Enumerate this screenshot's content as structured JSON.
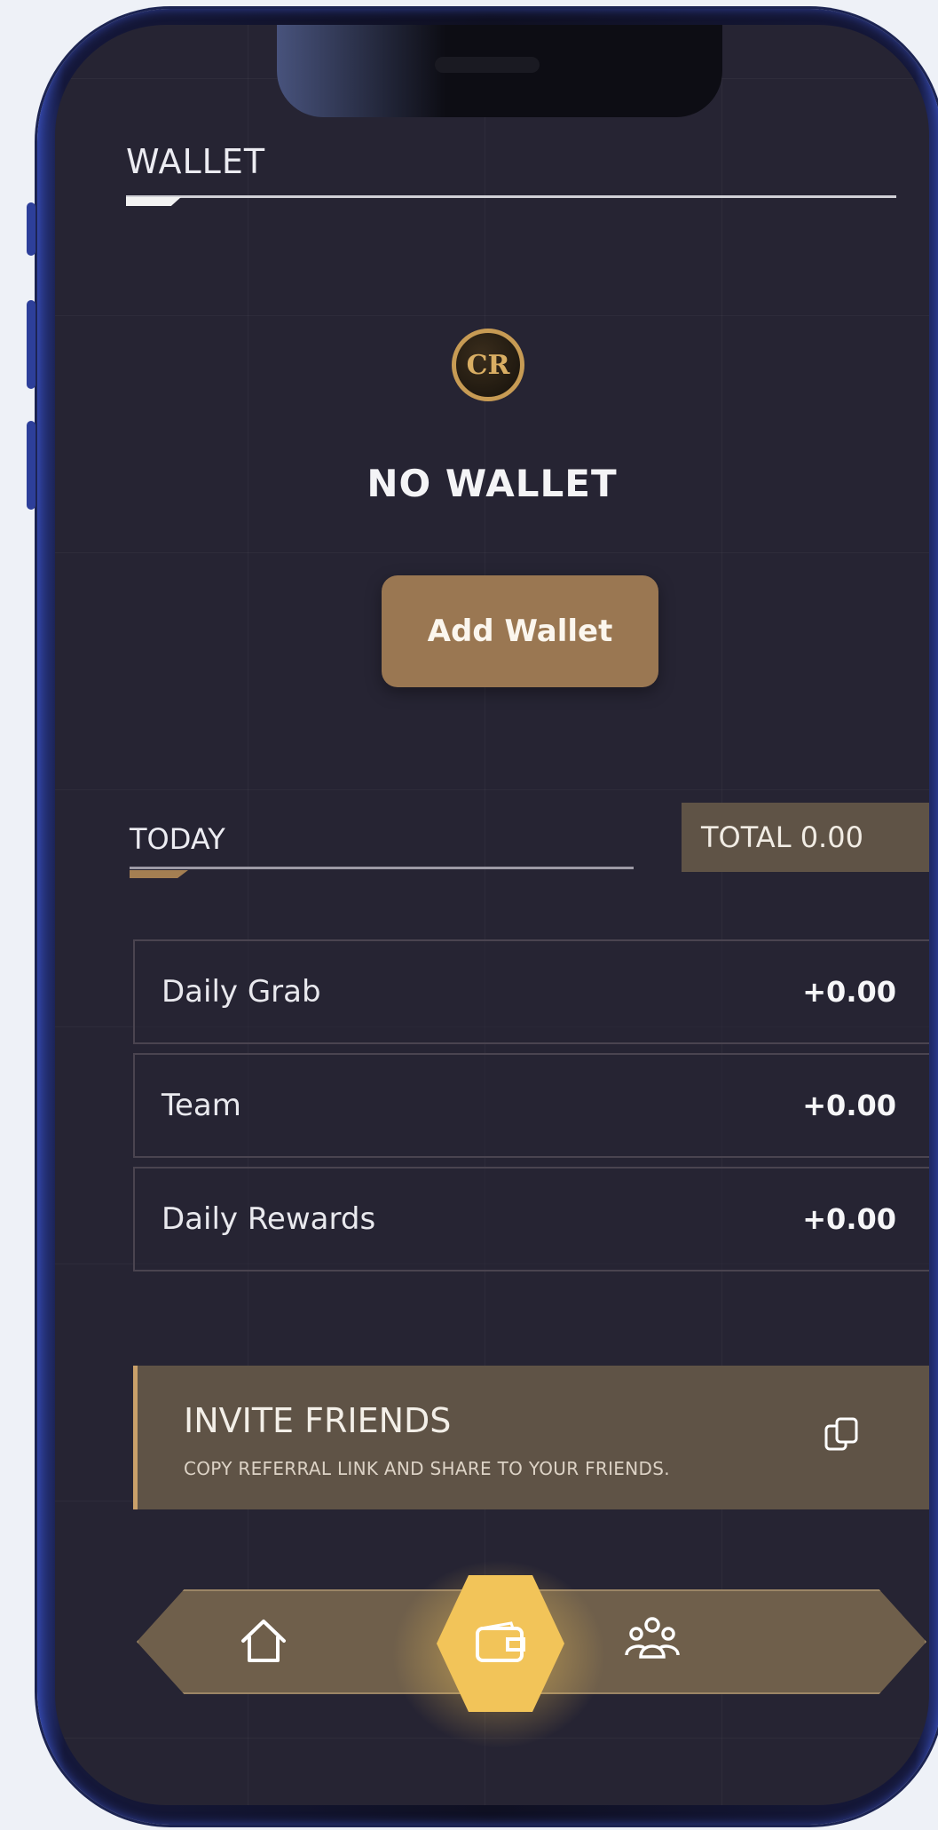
{
  "header": {
    "title": "WALLET"
  },
  "wallet": {
    "status": "NO WALLET",
    "add_button_label": "Add Wallet",
    "logo_text": "CR"
  },
  "earnings": {
    "tab_label": "TODAY",
    "total_label": "TOTAL 0.00",
    "rows": [
      {
        "label": "Daily Grab",
        "value": "+0.00"
      },
      {
        "label": "Team",
        "value": "+0.00"
      },
      {
        "label": "Daily Rewards",
        "value": "+0.00"
      }
    ]
  },
  "invite": {
    "title": "INVITE FRIENDS",
    "subtitle": "COPY REFERRAL LINK AND SHARE TO YOUR FRIENDS.",
    "icon": "copy-icon"
  },
  "bottom_nav": {
    "items": [
      {
        "icon": "home-icon",
        "active": false
      },
      {
        "icon": "wallet-icon",
        "active": true
      },
      {
        "icon": "team-icon",
        "active": false
      }
    ]
  },
  "colors": {
    "background": "#262433",
    "accent_brown": "#9a7752",
    "panel_brown": "#5f5346",
    "active_gold": "#f2c459"
  }
}
